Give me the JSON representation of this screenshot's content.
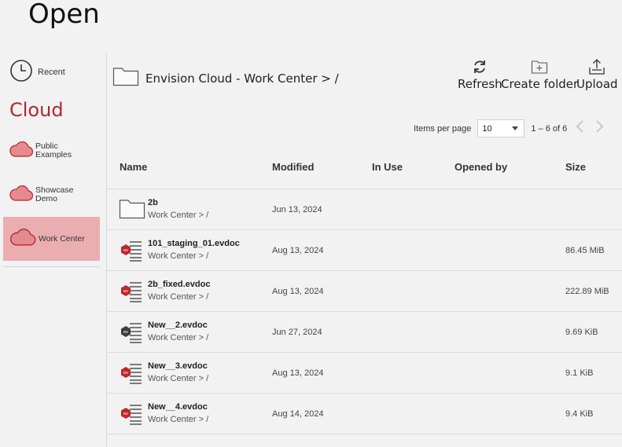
{
  "page": {
    "title": "Open"
  },
  "sidebar": {
    "recent_label": "Recent",
    "cloud_heading": "Cloud",
    "items": [
      {
        "label_line1": "Public",
        "label_line2": "Examples"
      },
      {
        "label_line1": "Showcase",
        "label_line2": "Demo"
      },
      {
        "label_line1": "Work Center",
        "label_line2": ""
      }
    ],
    "active_index": 2
  },
  "breadcrumb": {
    "text": "Envision Cloud - Work Center > /"
  },
  "toolbar": {
    "refresh_label": "Refresh",
    "create_folder_label": "Create folder",
    "upload_label": "Upload"
  },
  "pagination": {
    "items_per_page_label": "Items per page",
    "page_size": "10",
    "range_text": "1 – 6 of 6"
  },
  "table": {
    "columns": {
      "name": "Name",
      "modified": "Modified",
      "in_use": "In Use",
      "opened_by": "Opened by",
      "size": "Size"
    },
    "rows": [
      {
        "name": "2b",
        "path": "Work Center > /",
        "modified": "Jun 13, 2024",
        "size": "",
        "icon": "folder-icon"
      },
      {
        "name": "101_staging_01.evdoc",
        "path": "Work Center > /",
        "modified": "Aug 13, 2024",
        "size": "86.45 MiB",
        "icon": "evdoc-red-icon"
      },
      {
        "name": "2b_fixed.evdoc",
        "path": "Work Center > /",
        "modified": "Aug 13, 2024",
        "size": "222.89 MiB",
        "icon": "evdoc-red-icon"
      },
      {
        "name": "New__2.evdoc",
        "path": "Work Center > /",
        "modified": "Jun 27, 2024",
        "size": "9.69 KiB",
        "icon": "evdoc-dark-icon"
      },
      {
        "name": "New__3.evdoc",
        "path": "Work Center > /",
        "modified": "Aug 13, 2024",
        "size": "9.1 KiB",
        "icon": "evdoc-red-icon"
      },
      {
        "name": "New__4.evdoc",
        "path": "Work Center > /",
        "modified": "Aug 14, 2024",
        "size": "9.4 KiB",
        "icon": "evdoc-red-icon"
      }
    ]
  },
  "colors": {
    "accent": "#b0282f",
    "active_bg": "#eaaeb1",
    "cloud_fill": "#e58a8f",
    "evdoc_red": "#c0262e",
    "evdoc_dark": "#3a3d44"
  }
}
